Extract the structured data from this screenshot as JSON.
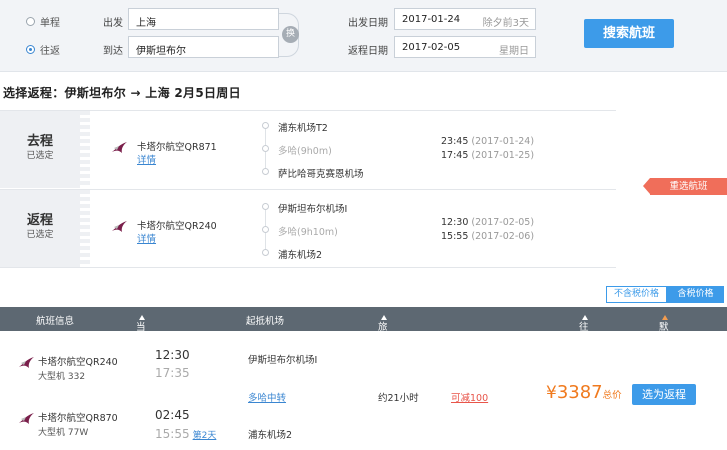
{
  "search": {
    "trip_types": [
      {
        "label": "单程",
        "selected": false
      },
      {
        "label": "往返",
        "selected": true
      }
    ],
    "from_label": "出发",
    "from_value": "上海",
    "to_label": "到达",
    "to_value": "伊斯坦布尔",
    "swap_label": "换",
    "depart_date_label": "出发日期",
    "depart_date_value": "2017-01-24",
    "depart_date_hint": "除夕前3天",
    "return_date_label": "返程日期",
    "return_date_value": "2017-02-05",
    "return_date_hint": "星期日",
    "search_button": "搜索航班"
  },
  "title": "选择返程：伊斯坦布尔 → 上海  2月5日周日",
  "legs": [
    {
      "side_title": "去程",
      "side_status": "已选定",
      "airline": "卡塔尔航空QR871",
      "detail_link": "详情",
      "stops": [
        "浦东机场T2",
        "多哈(9h0m)",
        "萨比哈哥克赛恩机场"
      ],
      "times": [
        {
          "time": "23:45",
          "date": "(2017-01-24)"
        },
        {
          "time": "17:45",
          "date": "(2017-01-25)"
        }
      ]
    },
    {
      "side_title": "返程",
      "side_status": "已选定",
      "airline": "卡塔尔航空QR240",
      "detail_link": "详情",
      "stops": [
        "伊斯坦布尔机场I",
        "多哈(9h10m)",
        "浦东机场2"
      ],
      "times": [
        {
          "time": "12:30",
          "date": "(2017-02-05)"
        },
        {
          "time": "15:55",
          "date": "(2017-02-06)"
        }
      ]
    }
  ],
  "reselect_button": "重选航班",
  "tax_toggle": {
    "exclude": "不含税价格",
    "include": "含税价格"
  },
  "table_headers": {
    "flight_info": "航班信息",
    "local_time": "当地起降时间",
    "airport": "起抵机场",
    "duration": "旅行总时长",
    "price": "往返 价格",
    "sort": "默认排序"
  },
  "result": {
    "segments": [
      {
        "airline": "卡塔尔航空QR240",
        "plane": "大型机 332",
        "dep": "12:30",
        "arr": "17:35",
        "next_day": "",
        "airport": "伊斯坦布尔机场I"
      },
      {
        "airline": "卡塔尔航空QR870",
        "plane": "大型机 77W",
        "dep": "02:45",
        "arr": "15:55",
        "next_day": "第2天",
        "airport": "浦东机场2"
      }
    ],
    "transfer": "多哈中转",
    "total_time": "约21小时",
    "discount": "可减100",
    "currency": "¥",
    "price": "3387",
    "price_label": "总价",
    "select_button": "选为返程"
  },
  "colors": {
    "accent": "#3d9be9",
    "price": "#f07a1e",
    "reselect": "#f06e5a",
    "header_bg": "#5d6872",
    "airline_logo": "#7a1f4b"
  }
}
